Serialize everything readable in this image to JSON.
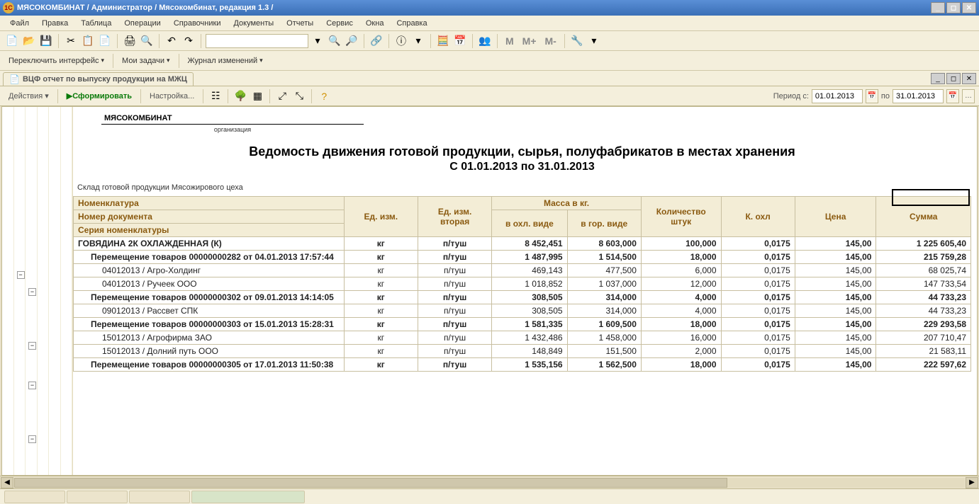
{
  "window": {
    "title": "МЯСОКОМБИНАТ / Администратор /  Мясокомбинат, редакция 1.3 /"
  },
  "menu": {
    "file": "Файл",
    "edit": "Правка",
    "table": "Таблица",
    "operations": "Операции",
    "references": "Справочники",
    "documents": "Документы",
    "reports": "Отчеты",
    "service": "Сервис",
    "windows": "Окна",
    "help": "Справка"
  },
  "toolbar2": {
    "switch_interface": "Переключить интерфейс",
    "my_tasks": "Мои задачи",
    "change_log": "Журнал изменений"
  },
  "tab": {
    "label": "ВЦФ отчет по выпуску продукции на МЖЦ"
  },
  "actions": {
    "actions": "Действия",
    "form": "Сформировать",
    "settings": "Настройка...",
    "period_from": "Период с:",
    "period_to": "по",
    "date_from": "01.01.2013",
    "date_to": "31.01.2013"
  },
  "report": {
    "org": "МЯСОКОМБИНАТ",
    "org_caption": "организация",
    "title": "Ведомость движения готовой продукции, сырья, полуфабрикатов в местах хранения",
    "period": "С 01.01.2013 по 31.01.2013",
    "warehouse": "Склад готовой продукции Мясожирового цеха",
    "headers": {
      "nom": "Номенклатура",
      "doc": "Номер документа",
      "series": "Серия номенклатуры",
      "unit": "Ед. изм.",
      "unit2": "Ед. изм. вторая",
      "mass": "Масса в кг.",
      "mass_cold": "в охл. виде",
      "mass_hot": "в гор. виде",
      "qty": "Количество штук",
      "k": "К. охл",
      "price": "Цена",
      "sum": "Сумма"
    },
    "rows": [
      {
        "lvl": 0,
        "txt": "ГОВЯДИНА 2К ОХЛАЖДЕННАЯ (К)",
        "unit": "кг",
        "unit2": "п/туш",
        "m1": "8 452,451",
        "m2": "8 603,000",
        "qty": "100,000",
        "k": "0,0175",
        "price": "145,00",
        "sum": "1 225 605,40"
      },
      {
        "lvl": 1,
        "txt": "Перемещение товаров 00000000282 от 04.01.2013 17:57:44",
        "unit": "кг",
        "unit2": "п/туш",
        "m1": "1 487,995",
        "m2": "1 514,500",
        "qty": "18,000",
        "k": "0,0175",
        "price": "145,00",
        "sum": "215 759,28"
      },
      {
        "lvl": 2,
        "txt": "04012013 / Агро-Холдинг",
        "unit": "кг",
        "unit2": "п/туш",
        "m1": "469,143",
        "m2": "477,500",
        "qty": "6,000",
        "k": "0,0175",
        "price": "145,00",
        "sum": "68 025,74"
      },
      {
        "lvl": 2,
        "txt": "04012013 / Ручеек ООО",
        "unit": "кг",
        "unit2": "п/туш",
        "m1": "1 018,852",
        "m2": "1 037,000",
        "qty": "12,000",
        "k": "0,0175",
        "price": "145,00",
        "sum": "147 733,54"
      },
      {
        "lvl": 1,
        "txt": "Перемещение товаров 00000000302 от 09.01.2013 14:14:05",
        "unit": "кг",
        "unit2": "п/туш",
        "m1": "308,505",
        "m2": "314,000",
        "qty": "4,000",
        "k": "0,0175",
        "price": "145,00",
        "sum": "44 733,23"
      },
      {
        "lvl": 2,
        "txt": "09012013 / Рассвет СПК",
        "unit": "кг",
        "unit2": "п/туш",
        "m1": "308,505",
        "m2": "314,000",
        "qty": "4,000",
        "k": "0,0175",
        "price": "145,00",
        "sum": "44 733,23"
      },
      {
        "lvl": 1,
        "txt": "Перемещение товаров 00000000303 от 15.01.2013 15:28:31",
        "unit": "кг",
        "unit2": "п/туш",
        "m1": "1 581,335",
        "m2": "1 609,500",
        "qty": "18,000",
        "k": "0,0175",
        "price": "145,00",
        "sum": "229 293,58"
      },
      {
        "lvl": 2,
        "txt": "15012013 / Агрофирма ЗАО",
        "unit": "кг",
        "unit2": "п/туш",
        "m1": "1 432,486",
        "m2": "1 458,000",
        "qty": "16,000",
        "k": "0,0175",
        "price": "145,00",
        "sum": "207 710,47"
      },
      {
        "lvl": 2,
        "txt": "15012013 / Долний путь ООО",
        "unit": "кг",
        "unit2": "п/туш",
        "m1": "148,849",
        "m2": "151,500",
        "qty": "2,000",
        "k": "0,0175",
        "price": "145,00",
        "sum": "21 583,11"
      },
      {
        "lvl": 1,
        "txt": "Перемещение товаров 00000000305 от 17.01.2013 11:50:38",
        "unit": "кг",
        "unit2": "п/туш",
        "m1": "1 535,156",
        "m2": "1 562,500",
        "qty": "18,000",
        "k": "0,0175",
        "price": "145,00",
        "sum": "222 597,62"
      }
    ]
  },
  "m_labels": {
    "m": "М",
    "mp": "М+",
    "mm": "М-"
  }
}
